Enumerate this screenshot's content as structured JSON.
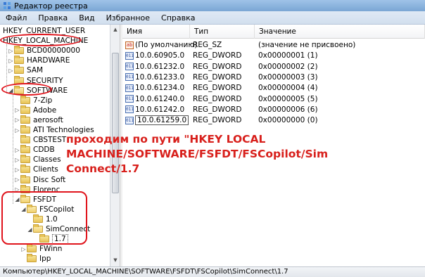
{
  "window": {
    "title": "Редактор реестра"
  },
  "menu": [
    "Файл",
    "Правка",
    "Вид",
    "Избранное",
    "Справка"
  ],
  "tree": [
    {
      "label": "HKEY_CURRENT_USER",
      "level": 0,
      "arrow": "",
      "folder": false
    },
    {
      "label": "HKEY_LOCAL_MACHINE",
      "level": 0,
      "arrow": "",
      "folder": false
    },
    {
      "label": "BCD00000000",
      "level": 1,
      "arrow": "▷",
      "folder": true
    },
    {
      "label": "HARDWARE",
      "level": 1,
      "arrow": "▷",
      "folder": true
    },
    {
      "label": "SAM",
      "level": 1,
      "arrow": "▷",
      "folder": true
    },
    {
      "label": "SECURITY",
      "level": 1,
      "arrow": "",
      "folder": true
    },
    {
      "label": "SOFTWARE",
      "level": 1,
      "arrow": "◢",
      "folder": true
    },
    {
      "label": "7-Zip",
      "level": 2,
      "arrow": "",
      "folder": true
    },
    {
      "label": "Adobe",
      "level": 2,
      "arrow": "▷",
      "folder": true
    },
    {
      "label": "aerosoft",
      "level": 2,
      "arrow": "▷",
      "folder": true
    },
    {
      "label": "ATI Technologies",
      "level": 2,
      "arrow": "▷",
      "folder": true
    },
    {
      "label": "CBSTEST",
      "level": 2,
      "arrow": "",
      "folder": true
    },
    {
      "label": "CDDB",
      "level": 2,
      "arrow": "▷",
      "folder": true
    },
    {
      "label": "Classes",
      "level": 2,
      "arrow": "▷",
      "folder": true
    },
    {
      "label": "Clients",
      "level": 2,
      "arrow": "▷",
      "folder": true
    },
    {
      "label": "Disc Soft",
      "level": 2,
      "arrow": "▷",
      "folder": true
    },
    {
      "label": "Florenc",
      "level": 2,
      "arrow": "▷",
      "folder": true
    },
    {
      "label": "FSFDT",
      "level": 2,
      "arrow": "◢",
      "folder": true
    },
    {
      "label": "FSCopilot",
      "level": 3,
      "arrow": "◢",
      "folder": true
    },
    {
      "label": "1.0",
      "level": 4,
      "arrow": "",
      "folder": true
    },
    {
      "label": "SimConnect",
      "level": 4,
      "arrow": "◢",
      "folder": true
    },
    {
      "label": "1.7",
      "level": 5,
      "arrow": "",
      "folder": true,
      "selected": true
    },
    {
      "label": "FWinn",
      "level": 3,
      "arrow": "▷",
      "folder": true
    },
    {
      "label": "Ipp",
      "level": 3,
      "arrow": "",
      "folder": true
    }
  ],
  "list": {
    "columns": [
      "Имя",
      "Тип",
      "Значение"
    ],
    "rows": [
      {
        "name": "(По умолчанию)",
        "type": "REG_SZ",
        "value": "(значение не присвоено)",
        "icon": "ab"
      },
      {
        "name": "10.0.60905.0",
        "type": "REG_DWORD",
        "value": "0x00000001 (1)",
        "icon": "dword"
      },
      {
        "name": "10.0.61232.0",
        "type": "REG_DWORD",
        "value": "0x00000002 (2)",
        "icon": "dword"
      },
      {
        "name": "10.0.61233.0",
        "type": "REG_DWORD",
        "value": "0x00000003 (3)",
        "icon": "dword"
      },
      {
        "name": "10.0.61234.0",
        "type": "REG_DWORD",
        "value": "0x00000004 (4)",
        "icon": "dword"
      },
      {
        "name": "10.0.61240.0",
        "type": "REG_DWORD",
        "value": "0x00000005 (5)",
        "icon": "dword"
      },
      {
        "name": "10.0.61242.0",
        "type": "REG_DWORD",
        "value": "0x00000006 (6)",
        "icon": "dword"
      },
      {
        "name": "10.0.61259.0",
        "type": "REG_DWORD",
        "value": "0x00000000 (0)",
        "icon": "dword",
        "editing": true
      }
    ]
  },
  "annotation": {
    "lines": [
      "проходим по пути \"HKEY LOCAL",
      "MACHINE/SOFTWARE/FSFDT/FSCopilot/Sim",
      "Connect/1.7"
    ],
    "color": "#d8201c"
  },
  "status_path": "Компьютер\\HKEY_LOCAL_MACHINE\\SOFTWARE\\FSFDT\\FSCopilot\\SimConnect\\1.7"
}
